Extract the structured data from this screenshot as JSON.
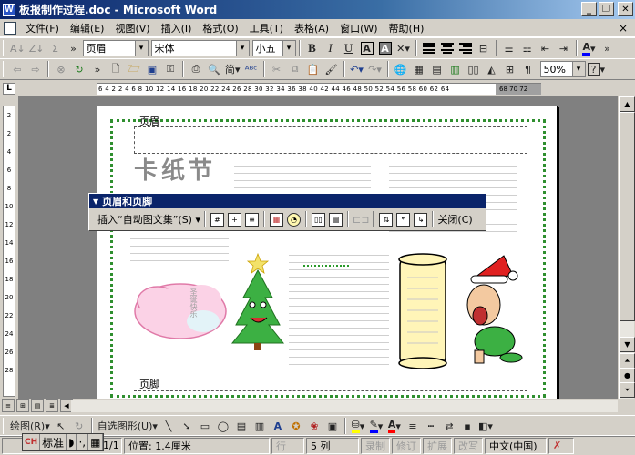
{
  "window": {
    "title": "板报制作过程.doc - Microsoft Word",
    "app_icon": "W",
    "minimize": "_",
    "restore": "❐",
    "close": "✕"
  },
  "menubar": {
    "items": [
      "文件(F)",
      "编辑(E)",
      "视图(V)",
      "插入(I)",
      "格式(O)",
      "工具(T)",
      "表格(A)",
      "窗口(W)",
      "帮助(H)"
    ],
    "close": "×"
  },
  "format_toolbar": {
    "chevron": "»",
    "style": "页眉",
    "font": "宋体",
    "size": "小五",
    "bold": "B",
    "italic": "I",
    "underline": "U",
    "char_border": "A",
    "font_color": "A"
  },
  "standard_toolbar": {
    "chevron": "»",
    "simplified": "简",
    "zoom": "50%",
    "help": "?"
  },
  "ruler": {
    "corner": "L",
    "ticks": "6  4  2    2  4  6  8  10 12 14 16 18 20 22 24 26 28 30 32 34 36 38 40 42 44 46 48 50 52 54 56 58 60 62 64",
    "tail_ticks": "68 70 72",
    "vticks": [
      "2",
      "",
      "2",
      "4",
      "6",
      "8",
      "10",
      "12",
      "14",
      "16",
      "18",
      "20",
      "22",
      "24",
      "26",
      "28"
    ]
  },
  "document": {
    "header_label": "页眉",
    "footer_label": "页脚",
    "title_art": "卡纸节",
    "bubble_text": "圣诞快乐"
  },
  "hf_toolbar": {
    "title": "页眉和页脚",
    "insert_autotext": "插入“自动图文集”(S)",
    "close": "关闭(C)"
  },
  "drawing_toolbar": {
    "draw": "绘图(R)",
    "autoshapes": "自选图形(U)"
  },
  "statusbar": {
    "page": "1/1",
    "position": "位置: 1.4厘米",
    "line": "行",
    "col": "5 列",
    "rec": "录制",
    "trk": "修订",
    "ext": "扩展",
    "ovr": "改写",
    "lang": "中文(中国)"
  },
  "ime": {
    "logo": "CH",
    "mode": "标准",
    "moon": "◗",
    "punct": "·,",
    "kbd": "▦"
  },
  "colors": {
    "titlebar_start": "#0a246a",
    "titlebar_end": "#a6caf0",
    "page_border": "#2f8f2f",
    "hf_title": "#0a246a"
  }
}
